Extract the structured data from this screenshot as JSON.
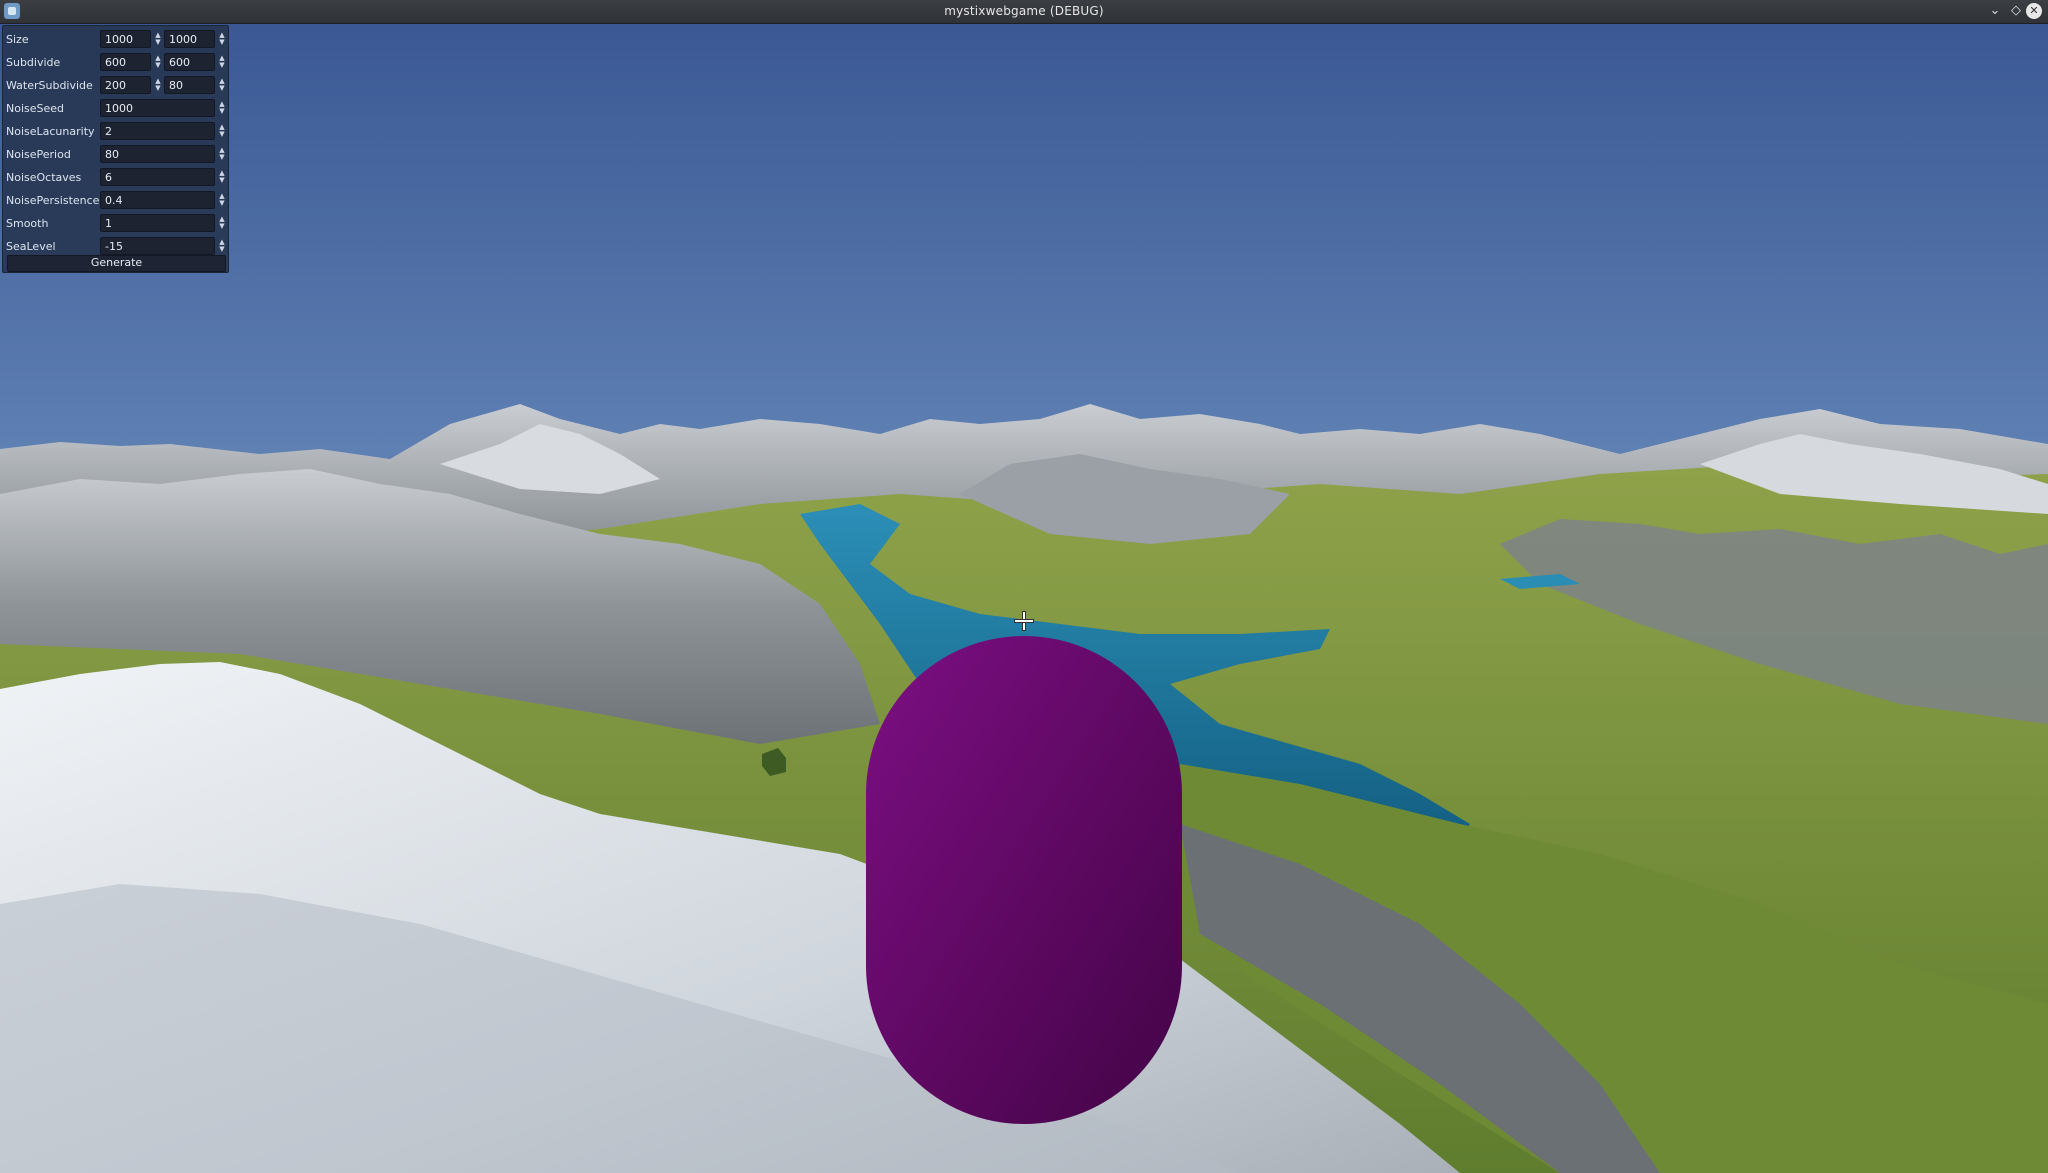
{
  "window": {
    "title": "mystixwebgame (DEBUG)",
    "icons": {
      "app": "app-icon",
      "minimize": "chevron-down-icon",
      "maximize": "diamond-icon",
      "close": "close-icon"
    }
  },
  "panel": {
    "rows": [
      {
        "label": "Size",
        "values": [
          "1000",
          "1000"
        ]
      },
      {
        "label": "Subdivide",
        "values": [
          "600",
          "600"
        ]
      },
      {
        "label": "WaterSubdivide",
        "values": [
          "200",
          "80"
        ]
      },
      {
        "label": "NoiseSeed",
        "values": [
          "1000"
        ]
      },
      {
        "label": "NoiseLacunarity",
        "values": [
          "2"
        ]
      },
      {
        "label": "NoisePeriod",
        "values": [
          "80"
        ]
      },
      {
        "label": "NoiseOctaves",
        "values": [
          "6"
        ]
      },
      {
        "label": "NoisePersistence",
        "values": [
          "0.4"
        ]
      },
      {
        "label": "Smooth",
        "values": [
          "1"
        ]
      },
      {
        "label": "SeaLevel",
        "values": [
          "-15"
        ]
      }
    ],
    "generate_label": "Generate"
  },
  "scene": {
    "colors": {
      "sky_top": "#3d5a95",
      "sky_horizon": "#86acd0",
      "water": "#1f7aa0",
      "grass": "#7d9a3a",
      "rock": "#8a8f94",
      "snow": "#e3e8ee",
      "player": "#6a0a6e"
    }
  }
}
